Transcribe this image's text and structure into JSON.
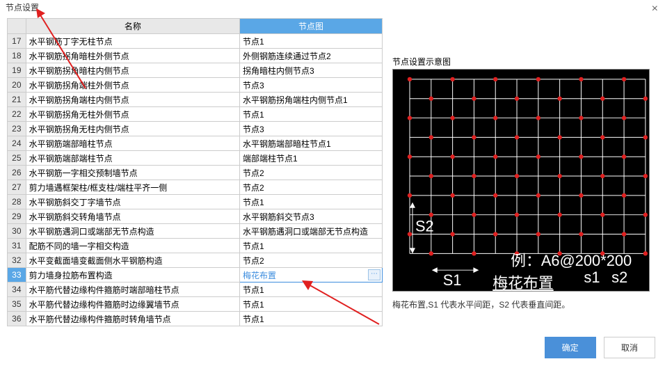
{
  "dialog": {
    "title": "节点设置",
    "close": "×"
  },
  "table": {
    "headers": {
      "name": "名称",
      "node": "节点图"
    },
    "rows": [
      {
        "num": "17",
        "name": "水平钢筋丁字无柱节点",
        "node": "节点1"
      },
      {
        "num": "18",
        "name": "水平钢筋拐角暗柱外侧节点",
        "node": "外侧钢筋连续通过节点2"
      },
      {
        "num": "19",
        "name": "水平钢筋拐角暗柱内侧节点",
        "node": "拐角暗柱内侧节点3"
      },
      {
        "num": "20",
        "name": "水平钢筋拐角端柱外侧节点",
        "node": "节点3"
      },
      {
        "num": "21",
        "name": "水平钢筋拐角端柱内侧节点",
        "node": "水平钢筋拐角端柱内侧节点1"
      },
      {
        "num": "22",
        "name": "水平钢筋拐角无柱外侧节点",
        "node": "节点1"
      },
      {
        "num": "23",
        "name": "水平钢筋拐角无柱内侧节点",
        "node": "节点3"
      },
      {
        "num": "24",
        "name": "水平钢筋端部暗柱节点",
        "node": "水平钢筋端部暗柱节点1"
      },
      {
        "num": "25",
        "name": "水平钢筋端部端柱节点",
        "node": "端部端柱节点1"
      },
      {
        "num": "26",
        "name": "水平钢筋一字相交预制墙节点",
        "node": "节点2"
      },
      {
        "num": "27",
        "name": "剪力墙遇框架柱/框支柱/端柱平齐一侧",
        "node": "节点2"
      },
      {
        "num": "28",
        "name": "水平钢筋斜交丁字墙节点",
        "node": "节点1"
      },
      {
        "num": "29",
        "name": "水平钢筋斜交转角墙节点",
        "node": "水平钢筋斜交节点3"
      },
      {
        "num": "30",
        "name": "水平钢筋遇洞口或端部无节点构造",
        "node": "水平钢筋遇洞口或端部无节点构造"
      },
      {
        "num": "31",
        "name": "配筋不同的墙一字相交构造",
        "node": "节点1"
      },
      {
        "num": "32",
        "name": "水平变截面墙变截面侧水平钢筋构造",
        "node": "节点2"
      },
      {
        "num": "33",
        "name": "剪力墙身拉筋布置构造",
        "node": ""
      },
      {
        "num": "34",
        "name": "水平筋代替边缘构件箍筋时端部暗柱节点",
        "node": "节点1"
      },
      {
        "num": "35",
        "name": "水平筋代替边缘构件箍筋时边缘翼墙节点",
        "node": "节点1"
      },
      {
        "num": "36",
        "name": "水平筋代替边缘构件箍筋时转角墙节点",
        "node": "节点1"
      }
    ],
    "selected_index": 16,
    "editing_value": "梅花布置",
    "ellipsis": "⋯"
  },
  "preview": {
    "title": "节点设置示意图",
    "sublabel": "梅花布置",
    "s1": "S1",
    "s2": "S2",
    "example": "例：A6@200*200",
    "s1_lower": "s1",
    "s2_lower": "s2",
    "desc": "梅花布置,S1 代表水平间距，S2 代表垂直间距。"
  },
  "footer": {
    "ok": "确定",
    "cancel": "取消"
  }
}
